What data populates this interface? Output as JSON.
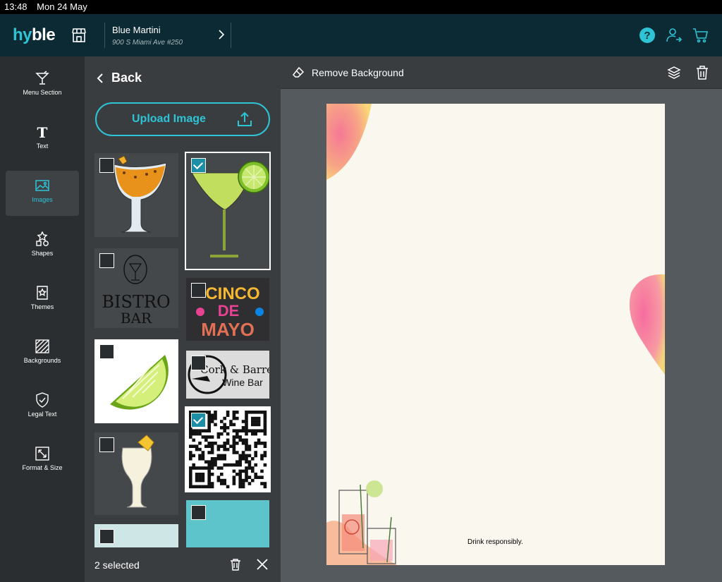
{
  "status": {
    "time": "13:48",
    "date": "Mon 24 May"
  },
  "brand": {
    "logo_a": "hy",
    "logo_b": "ble"
  },
  "venue": {
    "name": "Blue Martini",
    "address": "900 S Miami Ave #250"
  },
  "nav": [
    {
      "label": "Menu Section",
      "icon": "cocktail-icon"
    },
    {
      "label": "Text",
      "icon": "text-icon"
    },
    {
      "label": "Images",
      "icon": "image-icon",
      "active": true
    },
    {
      "label": "Shapes",
      "icon": "shapes-icon"
    },
    {
      "label": "Themes",
      "icon": "themes-icon"
    },
    {
      "label": "Backgrounds",
      "icon": "backgrounds-icon"
    },
    {
      "label": "Legal Text",
      "icon": "shield-icon"
    },
    {
      "label": "Format & Size",
      "icon": "resize-icon"
    }
  ],
  "panel": {
    "back_label": "Back",
    "upload_label": "Upload Image",
    "thumbnails": {
      "bistro": {
        "line1": "BISTRO",
        "line2": "BAR"
      },
      "cinco": {
        "line1": "CINCO",
        "line2": "DE",
        "line3": "MAYO"
      },
      "cork": {
        "line1": "Cork & Barrel",
        "line2": "Wine Bar"
      }
    },
    "selected_text": "2 selected"
  },
  "toolbar": {
    "remove_bg_label": "Remove Background"
  },
  "canvas": {
    "footer_text": "Drink responsibly."
  },
  "colors": {
    "accent": "#2ec4d6",
    "topbar": "#0c2a33",
    "check": "#1c8fa6"
  }
}
